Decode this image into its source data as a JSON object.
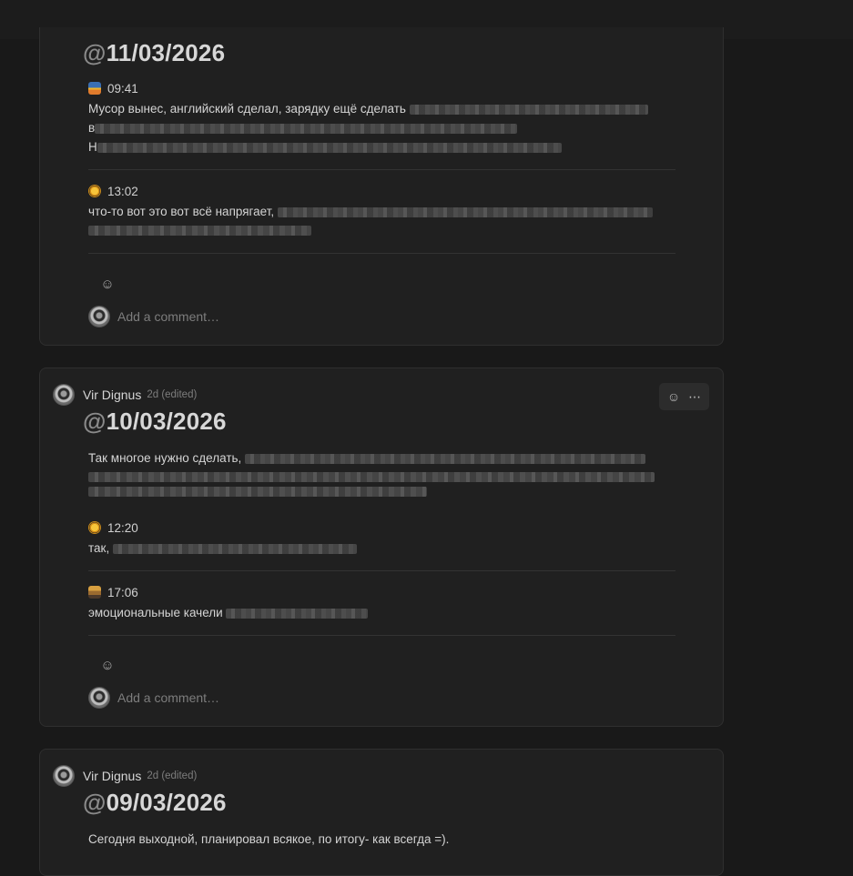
{
  "posts": [
    {
      "title_prefix": "@",
      "title_date": "11/03/2026",
      "entries": [
        {
          "icon": "sunrise-icon",
          "time": "09:41",
          "text": "Мусор вынес, английский сделал, зарядку ещё сделать",
          "line2": "в",
          "line3": "Н"
        },
        {
          "icon": "sun-icon",
          "time": "13:02",
          "text": "что-то вот это вот всё напрягает,"
        }
      ],
      "comment_placeholder": "Add a comment…"
    },
    {
      "author": "Vir Dignus",
      "meta": "2d (edited)",
      "title_prefix": "@",
      "title_date": "10/03/2026",
      "intro": "Так многое нужно сделать,",
      "entries": [
        {
          "icon": "sun-icon",
          "time": "12:20",
          "text": "так,"
        },
        {
          "icon": "sunset-icon",
          "time": "17:06",
          "text": "эмоциональные качели"
        }
      ],
      "comment_placeholder": "Add a comment…"
    },
    {
      "author": "Vir Dignus",
      "meta": "2d (edited)",
      "title_prefix": "@",
      "title_date": "09/03/2026",
      "intro": "Сегодня выходной, планировал всякое, по итогу- как всегда =)."
    }
  ],
  "icons": {
    "reaction": "add-reaction-icon",
    "more": "more-options-icon"
  }
}
